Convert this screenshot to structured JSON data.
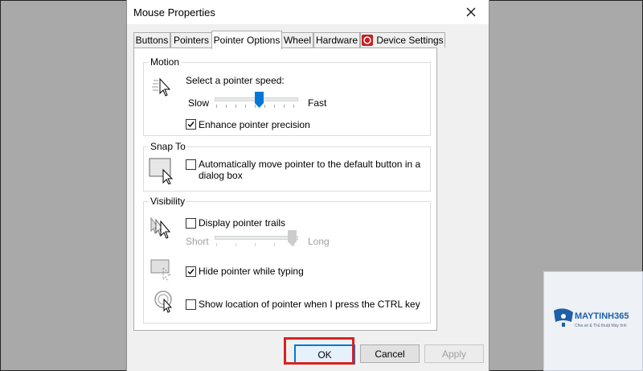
{
  "dialog": {
    "title": "Mouse Properties",
    "tabs": [
      {
        "label": "Buttons"
      },
      {
        "label": "Pointers"
      },
      {
        "label": "Pointer Options"
      },
      {
        "label": "Wheel"
      },
      {
        "label": "Hardware"
      },
      {
        "label": "Device Settings"
      }
    ],
    "motion": {
      "group_label": "Motion",
      "speed_label": "Select a pointer speed:",
      "slow_label": "Slow",
      "fast_label": "Fast",
      "speed_level": 0.55,
      "precision_label": "Enhance pointer precision",
      "precision_checked": true
    },
    "snap": {
      "group_label": "Snap To",
      "snap_label_line1": "Automatically move pointer to the default button in a",
      "snap_label_line2": "dialog box",
      "snap_checked": false
    },
    "visibility": {
      "group_label": "Visibility",
      "trails_label": "Display pointer trails",
      "trails_checked": false,
      "short_label": "Short",
      "long_label": "Long",
      "trail_level": 1.0,
      "hide_label": "Hide pointer while typing",
      "hide_checked": true,
      "ctrl_label": "Show location of pointer when I press the CTRL key",
      "ctrl_checked": false
    },
    "buttons": {
      "ok": "OK",
      "cancel": "Cancel",
      "apply": "Apply"
    }
  },
  "watermark": {
    "brand": "MAYTINH365",
    "tagline": "Chia sẻ & Thủ thuật Máy tính"
  },
  "colors": {
    "accent": "#0078d7",
    "highlight_red": "#d92121",
    "arrow_red": "#e31b1b",
    "brand_blue": "#1d5fa8"
  }
}
